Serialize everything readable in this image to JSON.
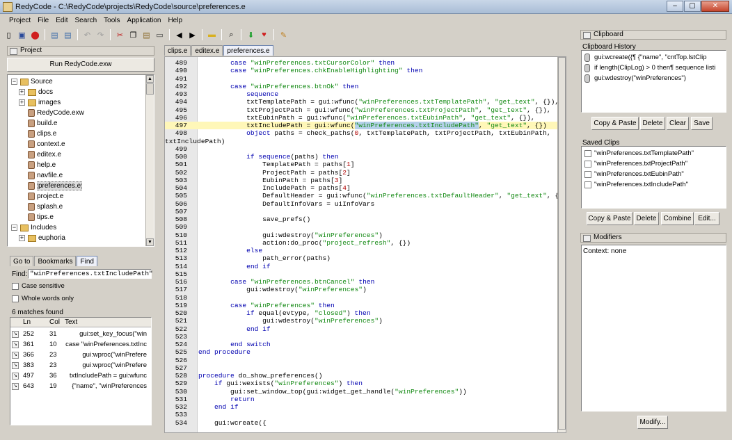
{
  "window": {
    "title": "RedyCode - C:\\RedyCode\\projects\\RedyCode\\source\\preferences.e"
  },
  "menu": [
    "Project",
    "File",
    "Edit",
    "Search",
    "Tools",
    "Application",
    "Help"
  ],
  "project_panel": {
    "header": "Project",
    "run_button": "Run RedyCode.exw",
    "tree": [
      {
        "label": "Source",
        "type": "folder",
        "expanded": true,
        "level": 0
      },
      {
        "label": "docs",
        "type": "folder",
        "level": 1
      },
      {
        "label": "images",
        "type": "folder",
        "level": 1
      },
      {
        "label": "RedyCode.exw",
        "type": "file",
        "level": 1
      },
      {
        "label": "build.e",
        "type": "file",
        "level": 1
      },
      {
        "label": "clips.e",
        "type": "file",
        "level": 1
      },
      {
        "label": "context.e",
        "type": "file",
        "level": 1
      },
      {
        "label": "editex.e",
        "type": "file",
        "level": 1
      },
      {
        "label": "help.e",
        "type": "file",
        "level": 1
      },
      {
        "label": "navfile.e",
        "type": "file",
        "level": 1
      },
      {
        "label": "preferences.e",
        "type": "file",
        "level": 1,
        "selected": true
      },
      {
        "label": "project.e",
        "type": "file",
        "level": 1
      },
      {
        "label": "splash.e",
        "type": "file",
        "level": 1
      },
      {
        "label": "tips.e",
        "type": "file",
        "level": 1
      },
      {
        "label": "Includes",
        "type": "folder",
        "expanded": true,
        "level": 0
      },
      {
        "label": "euphoria",
        "type": "folder",
        "level": 1
      }
    ]
  },
  "find_panel": {
    "tabs": [
      "Go to",
      "Bookmarks",
      "Find"
    ],
    "active_tab": "Find",
    "find_label": "Find:",
    "find_value": "\"winPreferences.txtIncludePath\"",
    "case_sensitive": "Case sensitive",
    "whole_words": "Whole words only",
    "matches": "6 matches found",
    "columns": [
      "Ln",
      "Col",
      "Text"
    ],
    "rows": [
      [
        "252",
        "31",
        "gui:set_key_focus(\"win"
      ],
      [
        "361",
        "10",
        "case \"winPreferences.txtInc"
      ],
      [
        "366",
        "23",
        "gui:wproc(\"winPrefere"
      ],
      [
        "383",
        "23",
        "gui:wproc(\"winPrefere"
      ],
      [
        "497",
        "36",
        "txtIncludePath = gui:wfunc"
      ],
      [
        "643",
        "19",
        "{\"name\", \"winPreferences"
      ]
    ]
  },
  "editor": {
    "tabs": [
      "clips.e",
      "editex.e",
      "preferences.e"
    ],
    "active_tab": "preferences.e",
    "highlight_line": "497",
    "lines": [
      [
        "489",
        "        case \"winPreferences.txtCursorColor\" then"
      ],
      [
        "490",
        "        case \"winPreferences.chkEnableHighlighting\" then"
      ],
      [
        "491",
        ""
      ],
      [
        "492",
        "        case \"winPreferences.btnOk\" then"
      ],
      [
        "493",
        "            sequence"
      ],
      [
        "494",
        "            txtTemplatePath = gui:wfunc(\"winPreferences.txtTemplatePath\", \"get_text\", {}),"
      ],
      [
        "495",
        "            txtProjectPath = gui:wfunc(\"winPreferences.txtProjectPath\", \"get_text\", {}),"
      ],
      [
        "496",
        "            txtEubinPath = gui:wfunc(\"winPreferences.txtEubinPath\", \"get_text\", {}),"
      ],
      [
        "497",
        "            txtIncludePath = gui:wfunc(\"winPreferences.txtIncludePath\", \"get_text\", {})"
      ],
      [
        "498",
        "            object paths = check_paths(0, txtTemplatePath, txtProjectPath, txtEubinPath,"
      ],
      [
        "",
        "txtIncludePath)"
      ],
      [
        "499",
        ""
      ],
      [
        "500",
        "            if sequence(paths) then"
      ],
      [
        "501",
        "                TemplatePath = paths[1]"
      ],
      [
        "502",
        "                ProjectPath = paths[2]"
      ],
      [
        "503",
        "                EubinPath = paths[3]"
      ],
      [
        "504",
        "                IncludePath = paths[4]"
      ],
      [
        "505",
        "                DefaultHeader = gui:wfunc(\"winPreferences.txtDefaultHeader\", \"get_text\", {})"
      ],
      [
        "506",
        "                DefaultInfoVars = uiInfoVars"
      ],
      [
        "507",
        ""
      ],
      [
        "508",
        "                save_prefs()"
      ],
      [
        "509",
        ""
      ],
      [
        "510",
        "                gui:wdestroy(\"winPreferences\")"
      ],
      [
        "511",
        "                action:do_proc(\"project_refresh\", {})"
      ],
      [
        "512",
        "            else"
      ],
      [
        "513",
        "                path_error(paths)"
      ],
      [
        "514",
        "            end if"
      ],
      [
        "515",
        ""
      ],
      [
        "516",
        "        case \"winPreferences.btnCancel\" then"
      ],
      [
        "517",
        "            gui:wdestroy(\"winPreferences\")"
      ],
      [
        "518",
        ""
      ],
      [
        "519",
        "        case \"winPreferences\" then"
      ],
      [
        "520",
        "            if equal(evtype, \"closed\") then"
      ],
      [
        "521",
        "                gui:wdestroy(\"winPreferences\")"
      ],
      [
        "522",
        "            end if"
      ],
      [
        "523",
        ""
      ],
      [
        "524",
        "        end switch"
      ],
      [
        "525",
        "end procedure"
      ],
      [
        "526",
        ""
      ],
      [
        "527",
        ""
      ],
      [
        "528",
        "procedure do_show_preferences()"
      ],
      [
        "529",
        "    if gui:wexists(\"winPreferences\") then"
      ],
      [
        "530",
        "        gui:set_window_top(gui:widget_get_handle(\"winPreferences\"))"
      ],
      [
        "531",
        "        return"
      ],
      [
        "532",
        "    end if"
      ],
      [
        "533",
        ""
      ],
      [
        "534",
        "    gui:wcreate({"
      ]
    ]
  },
  "clipboard_panel": {
    "header": "Clipboard",
    "history_label": "Clipboard History",
    "history": [
      "gui:wcreate({¶           {\"name\",  \"cntTop.lstClip",
      "if length(ClipLog) > 0 then¶          sequence listi",
      "gui:wdestroy(\"winPreferences\")"
    ],
    "history_buttons": [
      "Copy & Paste",
      "Delete",
      "Clear",
      "Save"
    ],
    "saved_label": "Saved Clips",
    "saved": [
      "\"winPreferences.txtTemplatePath\"",
      "\"winPreferences.txtProjectPath\"",
      "\"winPreferences.txtEubinPath\"",
      "\"winPreferences.txtIncludePath\""
    ],
    "saved_buttons": [
      "Copy & Paste",
      "Delete",
      "Combine",
      "Edit..."
    ]
  },
  "modifiers_panel": {
    "header": "Modifiers",
    "context": "Context: none",
    "modify_button": "Modify..."
  }
}
